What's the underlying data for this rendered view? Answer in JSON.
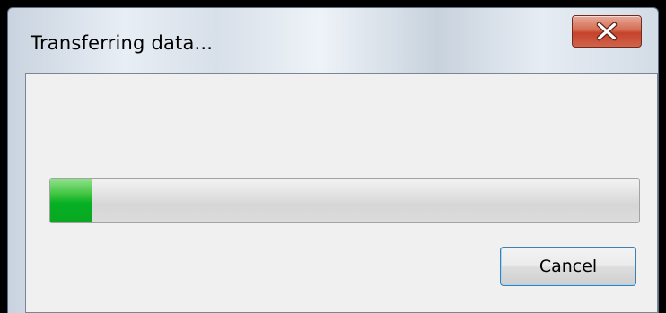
{
  "dialog": {
    "title": "Transferring data...",
    "close_icon": "close-x-icon",
    "progress": {
      "fraction": 0.07,
      "color": "#06b025"
    },
    "cancel_label": "Cancel"
  }
}
